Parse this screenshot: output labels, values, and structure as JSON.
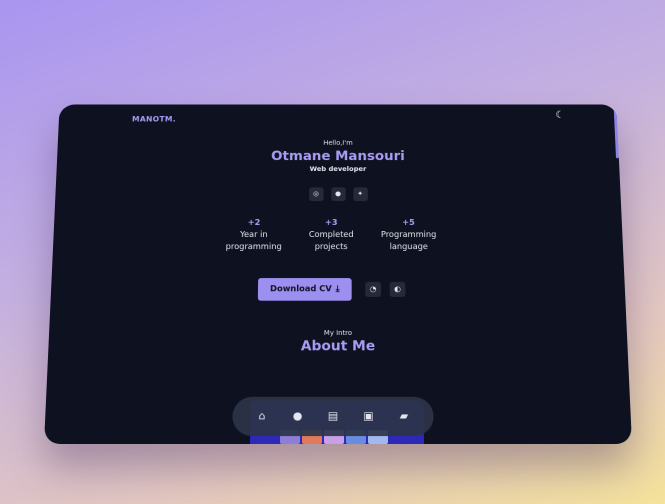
{
  "header": {
    "logo": "MANOTM.",
    "theme_icon": "moon-icon"
  },
  "hero": {
    "greeting": "Hello,I'm",
    "name": "Otmane Mansouri",
    "role": "Web developer",
    "socials": [
      {
        "name": "instagram-icon",
        "glyph": "◎"
      },
      {
        "name": "github-icon",
        "glyph": "●"
      },
      {
        "name": "twitter-icon",
        "glyph": "✦"
      }
    ]
  },
  "stats": [
    {
      "value": "+2",
      "line1": "Year in",
      "line2": "programming"
    },
    {
      "value": "+3",
      "line1": "Completed",
      "line2": "projects"
    },
    {
      "value": "+5",
      "line1": "Programming",
      "line2": "language"
    }
  ],
  "actions": {
    "download_label": "Download CV",
    "whatsapp_icon": "whatsapp-icon",
    "messenger_icon": "messenger-icon"
  },
  "about": {
    "subtitle": "My Intro",
    "title": "About Me"
  },
  "nav": [
    {
      "name": "nav-home",
      "icon": "home-icon",
      "glyph": "⌂"
    },
    {
      "name": "nav-about",
      "icon": "user-icon",
      "glyph": "●"
    },
    {
      "name": "nav-skills",
      "icon": "book-icon",
      "glyph": "▤"
    },
    {
      "name": "nav-portfolio",
      "icon": "briefcase-icon",
      "glyph": "▣"
    },
    {
      "name": "nav-contact",
      "icon": "message-icon",
      "glyph": "▰"
    }
  ],
  "colors": {
    "accent": "#a99cf5",
    "background": "#0e1220",
    "button": "#9d8ff0"
  }
}
